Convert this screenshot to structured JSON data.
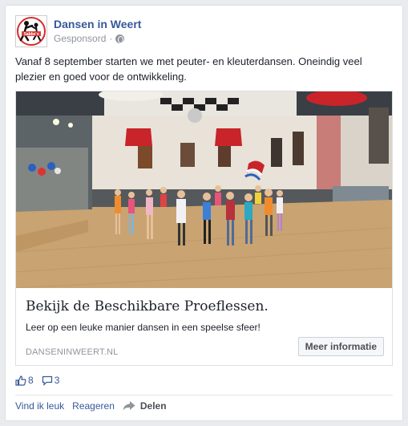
{
  "post": {
    "page_name": "Dansen in Weert",
    "sponsored": "Gesponsord",
    "separator": "·",
    "text": "Vanaf 8 september starten we met peuter- en kleuterdansen. Oneindig veel plezier en goed voor de ontwikkeling."
  },
  "logo": {
    "text": "Sabbe's",
    "subtext": "Dansen in Weert",
    "accent": "#d62b2b"
  },
  "link": {
    "title": "Bekijk de Beschikbare Proeflessen.",
    "description": "Leer op een leuke manier dansen in een speelse sfeer!",
    "domain": "DANSENINWEERT.NL",
    "cta": "Meer informatie"
  },
  "stats": {
    "likes": "8",
    "comments": "3"
  },
  "actions": {
    "like": "Vind ik leuk",
    "comment": "Reageren",
    "share": "Delen"
  },
  "colors": {
    "link_blue": "#365899",
    "muted": "#90949c",
    "floor": "#c9a371",
    "lamp_red": "#c8242a"
  }
}
